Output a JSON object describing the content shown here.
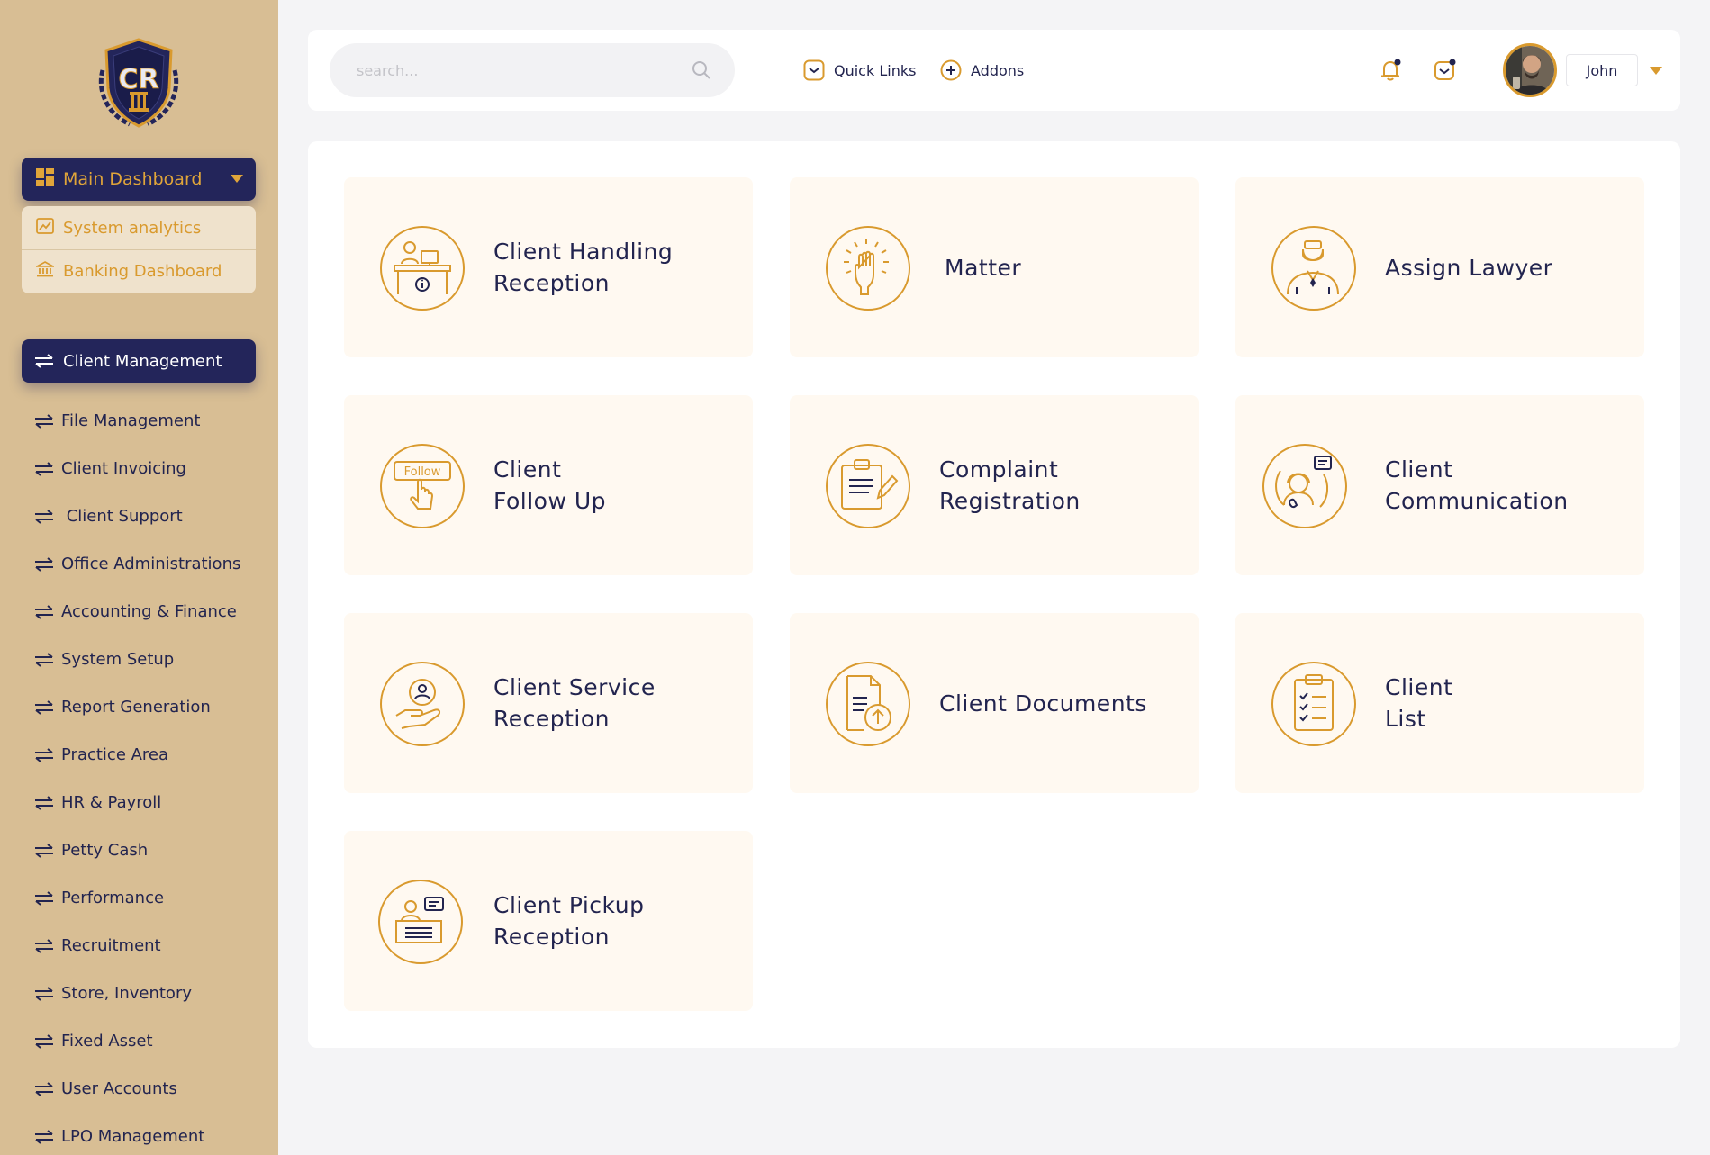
{
  "brand": {
    "logo_text": "CR"
  },
  "sidebar": {
    "dashboard": {
      "label": "Main Dashboard",
      "items": [
        {
          "label": "System analytics",
          "icon": "chart-icon"
        },
        {
          "label": "Banking Dashboard",
          "icon": "bank-icon"
        }
      ]
    },
    "active_section": {
      "label": "Client Management",
      "icon": "swap-arrows-icon"
    },
    "nav": [
      {
        "label": "File Management"
      },
      {
        "label": "Client Invoicing"
      },
      {
        "label": " Client Support"
      },
      {
        "label": "Office Administrations"
      },
      {
        "label": "Accounting & Finance"
      },
      {
        "label": "System Setup"
      },
      {
        "label": "Report Generation"
      },
      {
        "label": "Practice Area"
      },
      {
        "label": "HR & Payroll"
      },
      {
        "label": "Petty Cash"
      },
      {
        "label": "Performance"
      },
      {
        "label": "Recruitment"
      },
      {
        "label": "Store, Inventory"
      },
      {
        "label": "Fixed Asset"
      },
      {
        "label": "User Accounts"
      },
      {
        "label": "LPO Management"
      }
    ]
  },
  "topbar": {
    "search_placeholder": "search...",
    "quick_links": "Quick Links",
    "addons": "Addons",
    "user_name": "John"
  },
  "cards": [
    {
      "title": "Client Handling\nReception",
      "icon": "reception-desk-icon"
    },
    {
      "title": "Matter",
      "icon": "raised-fist-icon"
    },
    {
      "title": "Assign Lawyer",
      "icon": "lawyer-icon"
    },
    {
      "title": "Client\nFollow Up",
      "icon": "follow-click-icon",
      "icon_text": "Follow"
    },
    {
      "title": "Complaint\nRegistration",
      "icon": "clipboard-pen-icon"
    },
    {
      "title": "Client\nCommunication",
      "icon": "headset-chat-icon"
    },
    {
      "title": "Client Service\nReception",
      "icon": "hand-user-icon"
    },
    {
      "title": "Client Documents",
      "icon": "document-upload-icon"
    },
    {
      "title": "Client\nList",
      "icon": "checklist-icon"
    },
    {
      "title": "Client Pickup\nReception",
      "icon": "desk-chat-icon"
    }
  ],
  "colors": {
    "sidebar_bg": "#d8be94",
    "navy": "#23255a",
    "gold": "#d99a2e",
    "card_bg": "#fff9f1"
  }
}
